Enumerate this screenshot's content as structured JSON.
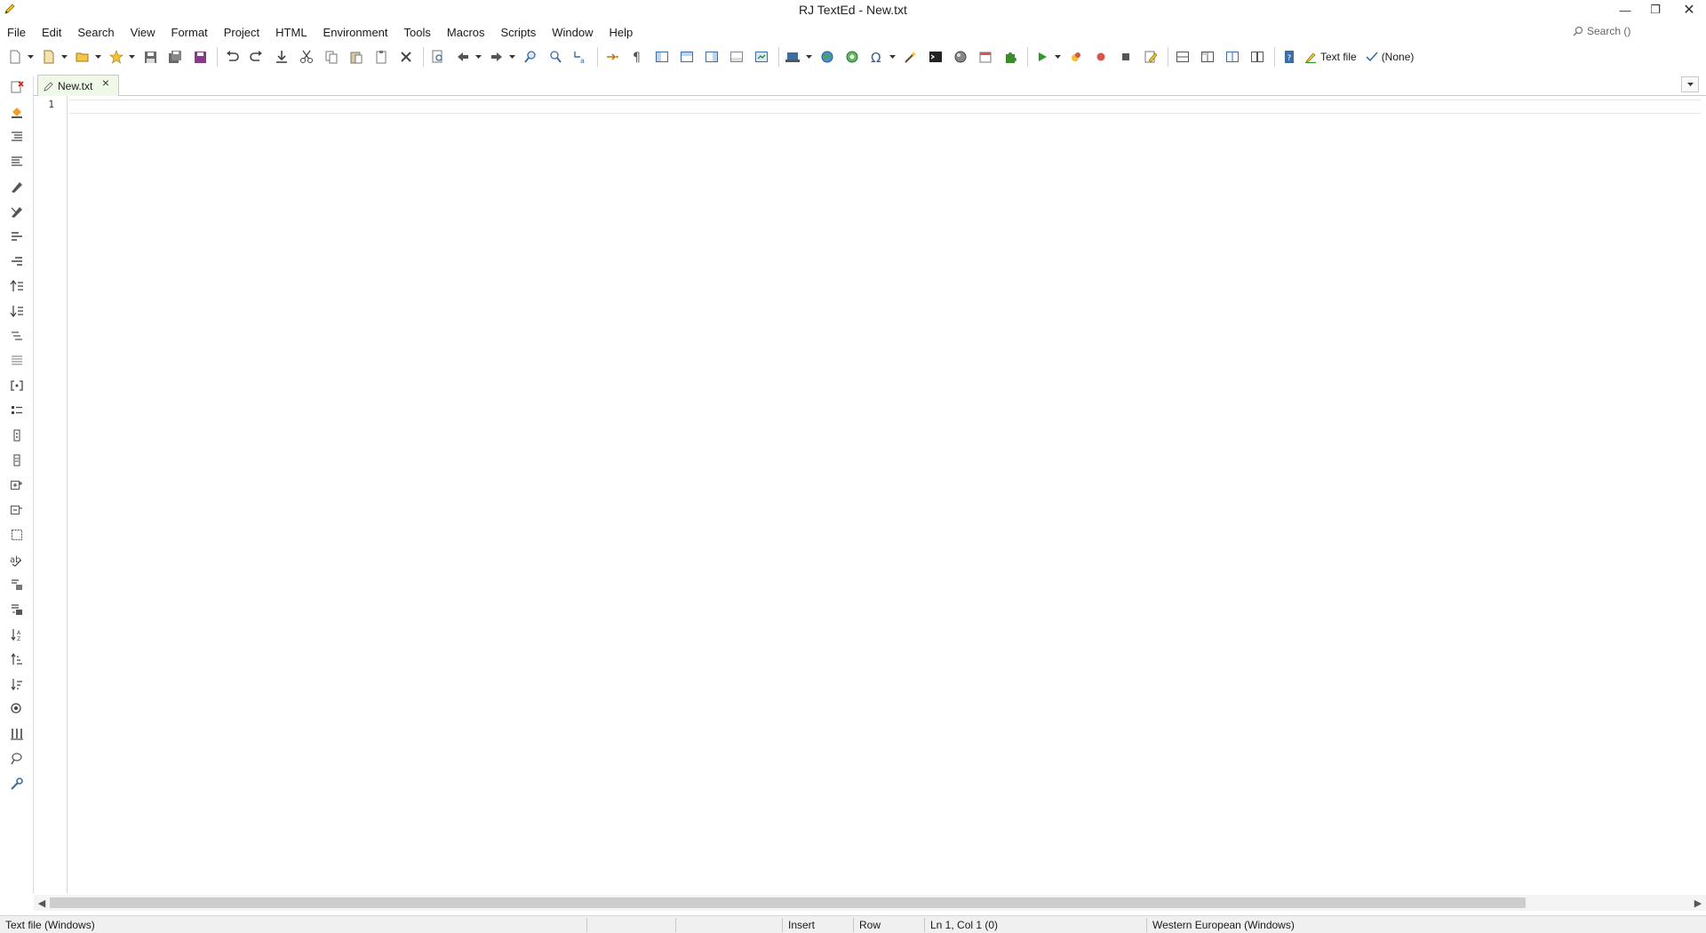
{
  "window": {
    "title": "RJ TextEd - New.txt",
    "minimize_glyph": "—",
    "maximize_glyph": "❐",
    "close_glyph": "✕"
  },
  "menubar": {
    "items": [
      "File",
      "Edit",
      "Search",
      "View",
      "Format",
      "Project",
      "HTML",
      "Environment",
      "Tools",
      "Macros",
      "Scripts",
      "Window",
      "Help"
    ]
  },
  "search": {
    "label": "Search ()"
  },
  "toolbar": {
    "highlighter_label": "Text file",
    "spellcheck_label": "(None)"
  },
  "tabs": [
    {
      "label": "New.txt",
      "active": true
    }
  ],
  "editor": {
    "line_numbers": [
      "1"
    ],
    "content": ""
  },
  "scrollbar": {
    "horizontal_thumb_fraction": 0.9
  },
  "statusbar": {
    "file_type": "Text file (Windows)",
    "mode": "Insert",
    "selection_mode": "Row",
    "position": "Ln 1, Col 1 (0)",
    "encoding": "Western European (Windows)"
  },
  "colors": {
    "accent_green": "#3c8c2c",
    "tab_background": "#f0f8e8",
    "close_red": "#cc2222"
  }
}
